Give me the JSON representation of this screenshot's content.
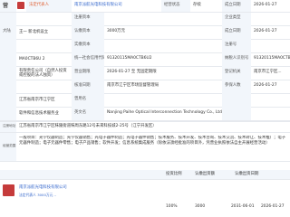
{
  "header": {
    "left_char": "营",
    "tag_text": "法定代表人",
    "col1_label": "法定代表人",
    "col2_value": "南京派航光电科技有限公司",
    "col3_label": "经营状态",
    "col3_value": "存续",
    "col4_label": "成立日期",
    "col4_value": "2026-01-27"
  },
  "rows": [
    {
      "side": "",
      "c1": "",
      "c2_label": "注册资本",
      "c2_value": "",
      "c3_label": "企业类型",
      "c3_value": ""
    },
    {
      "side": "大陆",
      "c1": "王一  新北机设立",
      "c2_label": "认缴资本",
      "c2_value": "3000万元",
      "c3_label": "成立日期",
      "c3_value": "2026-01-27"
    },
    {
      "side": "",
      "c1": "",
      "c2_label": "实缴资本",
      "c2_value": "",
      "c3_label": "注册号",
      "c3_value": ""
    },
    {
      "side": "",
      "c1": "MA0CTB6U 2",
      "c2_label": "统一社会信用代码",
      "c2_value": "91320115MA0CTB6U2",
      "c3_label": "纳税人识别号",
      "c3_value": "91320115MA0CTB6U2"
    },
    {
      "side": "",
      "c1": "有限责任公司（自然人投资或控股的法人独资）",
      "c2_label": "营业期限",
      "c2_value": "2026-01-27 至 无固定期限",
      "c3_label": "登记机关",
      "c3_value": "南京市江宁区..."
    },
    {
      "side": "",
      "c1": "",
      "c2_label": "核准日期",
      "c2_value": "南京市江宁区市场监督管理局",
      "c3_label": "参保人数",
      "c3_value": "2026-01-27"
    },
    {
      "side": "",
      "c1": "江苏省南京市江宁区",
      "c2_label": "曾用名",
      "c2_value": "",
      "c3_label": "",
      "c3_value": ""
    },
    {
      "side": "",
      "c1": "软件和信息技术服务业",
      "c2_label": "英文名",
      "c2_value": "Nanjing Paihe Optical Interconnection Technology Co., Ltd.",
      "c3_label": "",
      "c3_value": ""
    }
  ],
  "address_label": "注册地址",
  "address_value": "江苏省南京市江宁区秣陵街道秣周东路12号未来科技城2-25号（江宁开发区）",
  "scope_label": "经营范围",
  "scope_value": "一般项目：光学仪器制造；光学仪器销售；光电子器件制造；光电子器件销售；技术服务、技术开发、技术咨询、技术交流、技术转让、技术推广；电子元器件制造；电子元器件零售；电子产品销售；软件开发；信息系统集成服务（除依法须经批准的项目外，凭营业执照依法自主开展经营活动）",
  "table_headers": [
    "",
    "投资比例",
    "认缴出资额",
    "认缴出资日期",
    ""
  ],
  "table_rows": [
    {
      "name": "南京派航光电科技有限公司",
      "sub": "法定代表人 3000万元 ..",
      "ratio": "100%",
      "amount": "3000",
      "date": "2031-06-01",
      "date2": "2026-01-27"
    }
  ],
  "colors": {
    "accent": "#3366cc",
    "label_bg": "#f2f6fb",
    "border": "#e6e9ee",
    "tag": "#e06236"
  }
}
